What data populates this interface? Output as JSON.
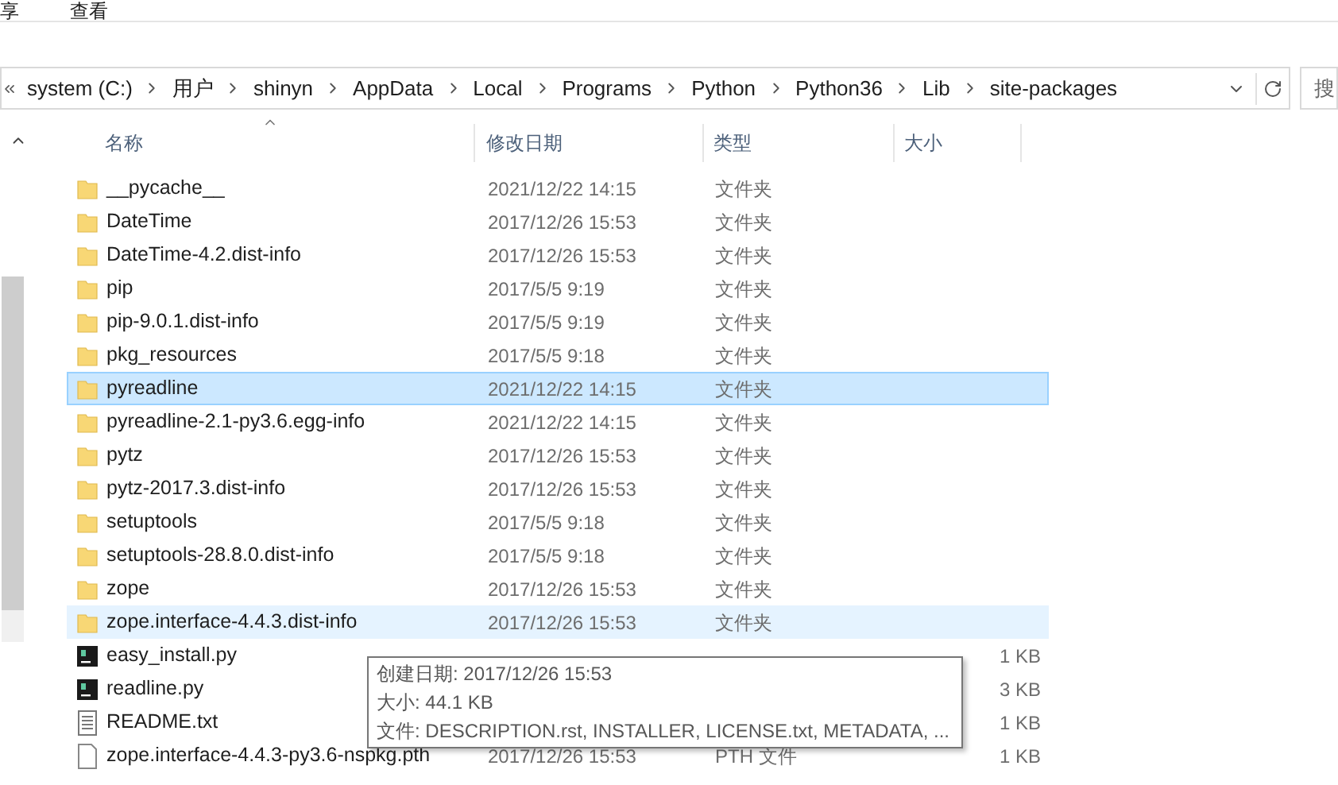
{
  "ribbon_tabs": [
    {
      "label": "享",
      "selected": false
    },
    {
      "label": "查看",
      "selected": false
    }
  ],
  "address_bar": {
    "crumbs": [
      "system (C:)",
      "用户",
      "shinyn",
      "AppData",
      "Local",
      "Programs",
      "Python",
      "Python36",
      "Lib",
      "site-packages"
    ]
  },
  "search": {
    "placeholder": "搜"
  },
  "table": {
    "columns": [
      "名称",
      "修改日期",
      "类型",
      "大小"
    ],
    "rows": [
      {
        "kind": "folder",
        "name": "__pycache__",
        "date": "2021/12/22 14:15",
        "type": "文件夹",
        "selected": false,
        "hovered": false
      },
      {
        "kind": "folder",
        "name": "DateTime",
        "date": "2017/12/26 15:53",
        "type": "文件夹",
        "selected": false,
        "hovered": false
      },
      {
        "kind": "folder",
        "name": "DateTime-4.2.dist-info",
        "date": "2017/12/26 15:53",
        "type": "文件夹",
        "selected": false,
        "hovered": false
      },
      {
        "kind": "folder",
        "name": "pip",
        "date": "2017/5/5 9:19",
        "type": "文件夹",
        "selected": false,
        "hovered": false
      },
      {
        "kind": "folder",
        "name": "pip-9.0.1.dist-info",
        "date": "2017/5/5 9:19",
        "type": "文件夹",
        "selected": false,
        "hovered": false
      },
      {
        "kind": "folder",
        "name": "pkg_resources",
        "date": "2017/5/5 9:18",
        "type": "文件夹",
        "selected": false,
        "hovered": false
      },
      {
        "kind": "folder",
        "name": "pyreadline",
        "date": "2021/12/22 14:15",
        "type": "文件夹",
        "selected": true,
        "hovered": false
      },
      {
        "kind": "folder",
        "name": "pyreadline-2.1-py3.6.egg-info",
        "date": "2021/12/22 14:15",
        "type": "文件夹",
        "selected": false,
        "hovered": false
      },
      {
        "kind": "folder",
        "name": "pytz",
        "date": "2017/12/26 15:53",
        "type": "文件夹",
        "selected": false,
        "hovered": false
      },
      {
        "kind": "folder",
        "name": "pytz-2017.3.dist-info",
        "date": "2017/12/26 15:53",
        "type": "文件夹",
        "selected": false,
        "hovered": false
      },
      {
        "kind": "folder",
        "name": "setuptools",
        "date": "2017/5/5 9:18",
        "type": "文件夹",
        "selected": false,
        "hovered": false
      },
      {
        "kind": "folder",
        "name": "setuptools-28.8.0.dist-info",
        "date": "2017/5/5 9:18",
        "type": "文件夹",
        "selected": false,
        "hovered": false
      },
      {
        "kind": "folder",
        "name": "zope",
        "date": "2017/12/26 15:53",
        "type": "文件夹",
        "selected": false,
        "hovered": false
      },
      {
        "kind": "folder",
        "name": "zope.interface-4.4.3.dist-info",
        "date": "2017/12/26 15:53",
        "type": "文件夹",
        "selected": false,
        "hovered": true
      },
      {
        "kind": "python",
        "name": "easy_install.py",
        "size": "1 KB",
        "selected": false,
        "hovered": false
      },
      {
        "kind": "python",
        "name": "readline.py",
        "size": "3 KB",
        "selected": false,
        "hovered": false
      },
      {
        "kind": "text",
        "name": "README.txt",
        "size": "1 KB",
        "selected": false,
        "hovered": false
      },
      {
        "kind": "file",
        "name": "zope.interface-4.4.3-py3.6-nspkg.pth",
        "date": "2017/12/26 15:53",
        "type": "PTH 文件",
        "size": "1 KB",
        "selected": false,
        "hovered": false
      }
    ]
  },
  "tooltip": {
    "lines": [
      "创建日期: 2017/12/26 15:53",
      "大小: 44.1 KB",
      "文件: DESCRIPTION.rst, INSTALLER, LICENSE.txt, METADATA, ..."
    ]
  }
}
